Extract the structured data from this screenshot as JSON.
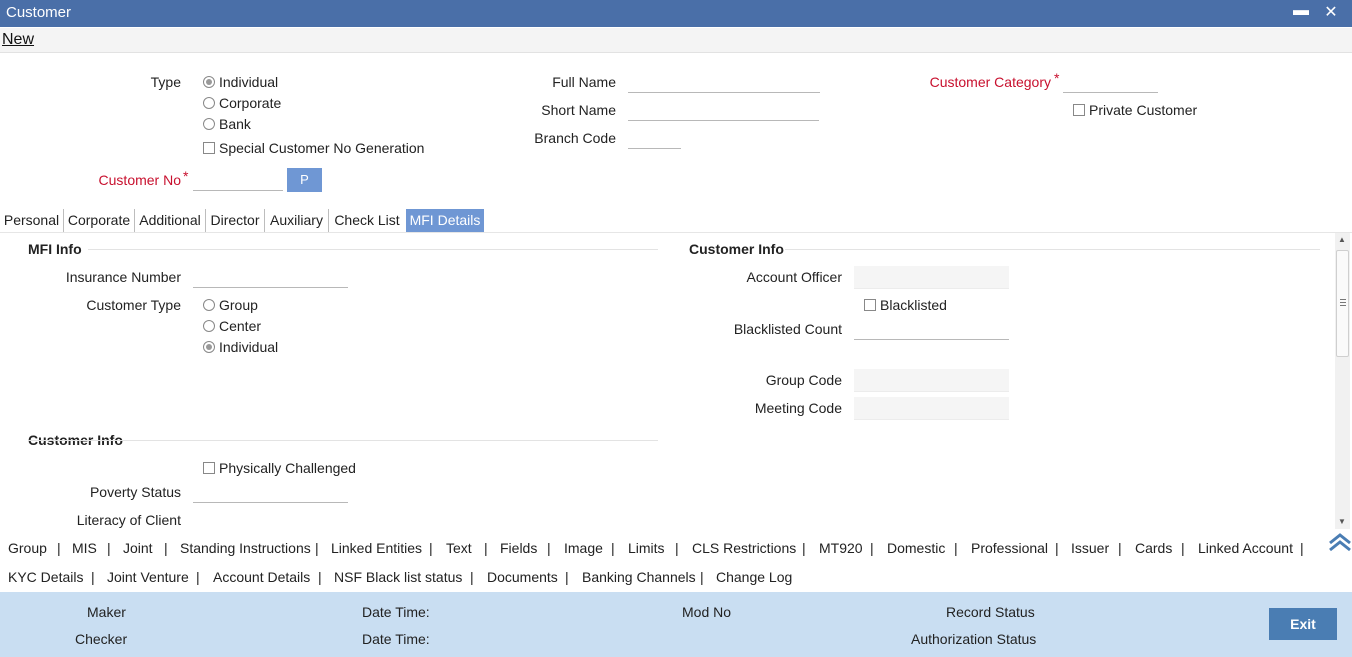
{
  "window": {
    "title": "Customer",
    "minimize": "▬",
    "close": "✕"
  },
  "menu": {
    "new": "New"
  },
  "header": {
    "type_label": "Type",
    "type_options": [
      "Individual",
      "Corporate",
      "Bank"
    ],
    "type_selected": "Individual",
    "special_no_gen": "Special Customer No Generation",
    "customer_no_label": "Customer No",
    "required_mark": "*",
    "p_button": "P",
    "full_name_label": "Full Name",
    "short_name_label": "Short Name",
    "branch_code_label": "Branch Code",
    "customer_category_label": "Customer Category",
    "private_customer": "Private Customer"
  },
  "tabs": [
    "Personal",
    "Corporate",
    "Additional",
    "Director",
    "Auxiliary",
    "Check List",
    "MFI Details"
  ],
  "active_tab": "MFI Details",
  "mfi_info": {
    "title": "MFI Info",
    "insurance_number_label": "Insurance Number",
    "customer_type_label": "Customer Type",
    "customer_type_options": [
      "Group",
      "Center",
      "Individual"
    ],
    "customer_type_selected": "Individual"
  },
  "customer_info_right": {
    "title": "Customer Info",
    "account_officer_label": "Account Officer",
    "blacklisted": "Blacklisted",
    "blacklisted_count_label": "Blacklisted Count",
    "group_code_label": "Group Code",
    "meeting_code_label": "Meeting Code"
  },
  "customer_info_left": {
    "title": "Customer Info",
    "physically_challenged": "Physically Challenged",
    "poverty_status_label": "Poverty Status",
    "literacy_label": "Literacy of Client"
  },
  "links_row1": [
    "Group",
    "MIS",
    "Joint",
    "Standing Instructions",
    "Linked Entities",
    "Text",
    "Fields",
    "Image",
    "Limits",
    "CLS Restrictions",
    "MT920",
    "Domestic",
    "Professional",
    "Issuer",
    "Cards",
    "Linked Account"
  ],
  "links_row2": [
    "KYC Details",
    "Joint Venture",
    "Account Details",
    "NSF Black list status",
    "Documents",
    "Banking Channels",
    "Change Log"
  ],
  "separator": "|",
  "footer": {
    "maker": "Maker",
    "checker": "Checker",
    "date_time_1": "Date Time:",
    "date_time_2": "Date Time:",
    "mod_no": "Mod No",
    "record_status": "Record Status",
    "authorization_status": "Authorization Status",
    "exit": "Exit"
  },
  "colors": {
    "titlebar": "#4a6fa8",
    "active_tab": "#6f97d4",
    "required": "#c8102e",
    "footer": "#c9def2",
    "exit_button": "#4a7db3"
  }
}
